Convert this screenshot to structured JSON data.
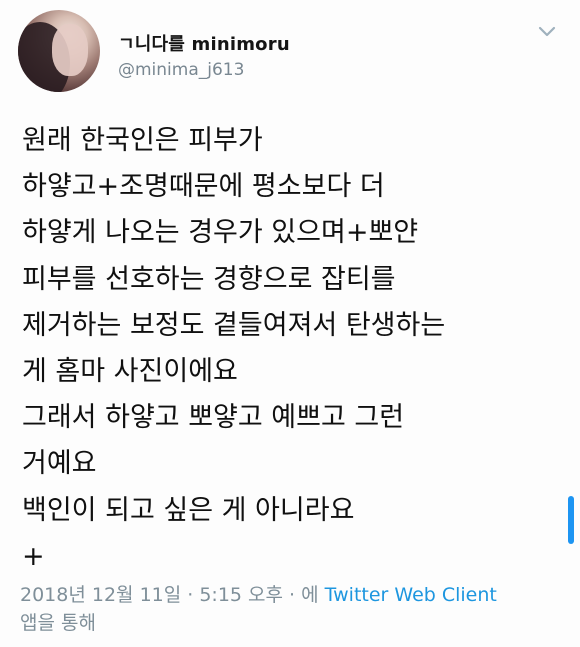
{
  "tweet": {
    "author": {
      "display_name": "ㄱ니다를 minimoru",
      "handle": "@minima_j613"
    },
    "body_lines": [
      "원래 한국인은 피부가",
      "하얗고+조명때문에 평소보다 더",
      "하얗게 나오는 경우가 있으며+뽀얀",
      "피부를 선호하는 경향으로 잡티를",
      "제거하는 보정도 곁들여져서 탄생하는",
      "게 홈마 사진이에요",
      "그래서 하얗고 뽀얗고 예쁘고 그런",
      "거예요",
      "백인이 되고 싶은 게 아니라요",
      "+"
    ],
    "timestamp": "2018년 12월 11일 · 5:15 오후 · 에",
    "source": "Twitter Web Client",
    "source_suffix": "앱을 통해"
  },
  "icons": {
    "menu": "chevron-down-icon"
  },
  "colors": {
    "text": "#101010",
    "secondary": "#7f8f99",
    "link": "#1d96df",
    "scroll_indicator": "#1d95f2"
  }
}
